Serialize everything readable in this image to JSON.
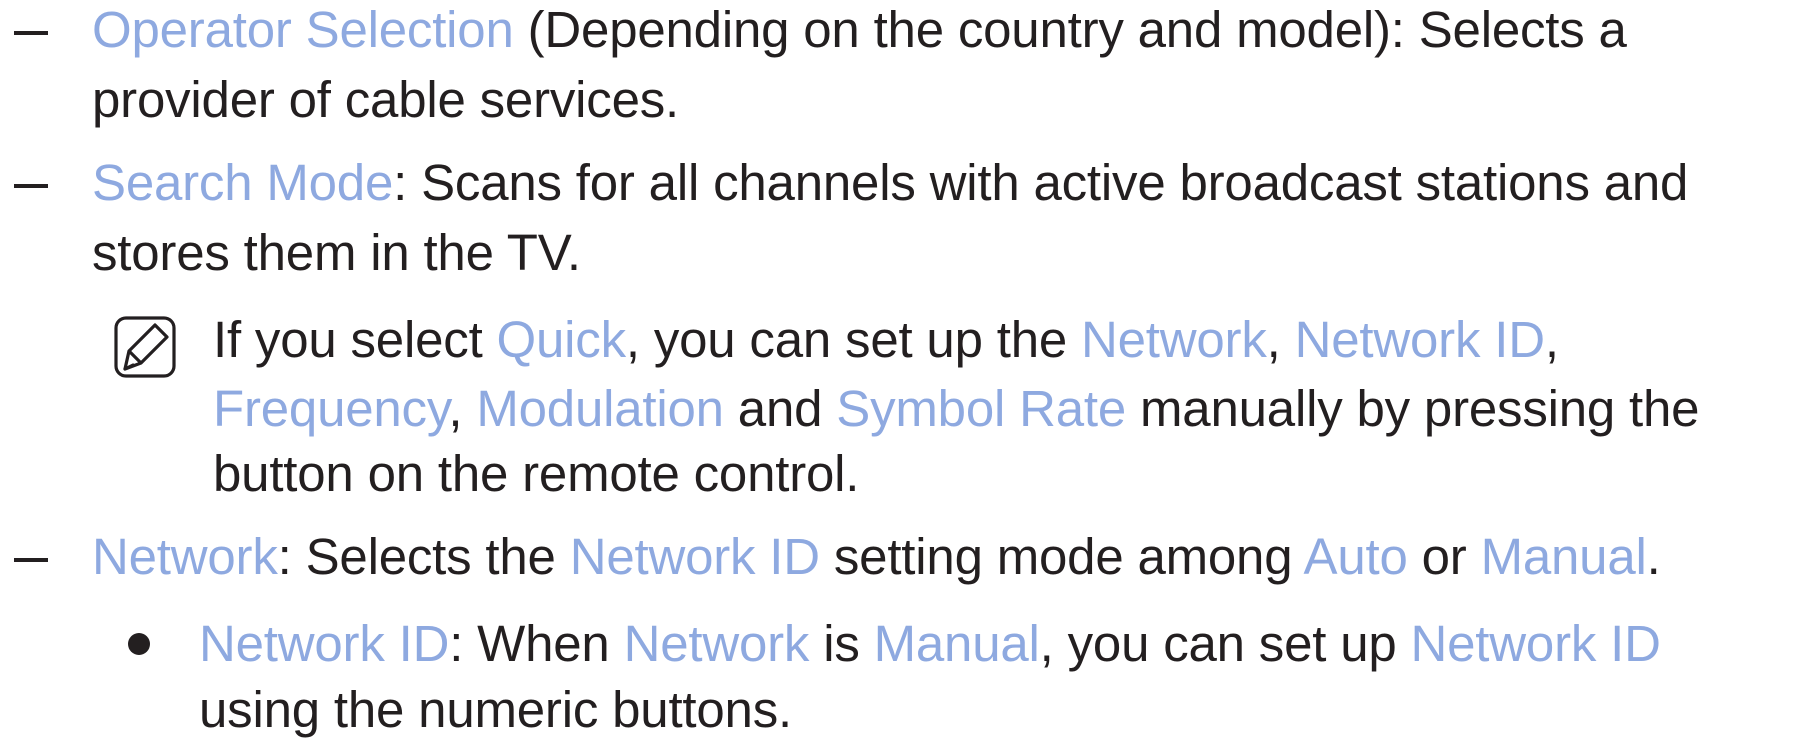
{
  "items": [
    {
      "term": "Operator Selection",
      "line1_rest": " (Depending on the country and model): Selects a",
      "line2": "provider of cable services."
    },
    {
      "term": "Search Mode",
      "line1_rest": ": Scans for all channels with active broadcast stations and",
      "line2": "stores them in the TV."
    }
  ],
  "note": {
    "icon": "note-icon",
    "line1": {
      "t1": "If you select ",
      "quick": "Quick",
      "t2": ", you can set up the ",
      "network": "Network",
      "t3": ", ",
      "network_id": "Network ID",
      "t4": ","
    },
    "line2": {
      "frequency": "Frequency",
      "t1": ", ",
      "modulation": "Modulation",
      "t2": " and ",
      "symbol_rate": "Symbol Rate",
      "t3": " manually by pressing the"
    },
    "line3": "button on the remote control."
  },
  "network_item": {
    "term": "Network",
    "t1": ": Selects the ",
    "network_id": "Network ID",
    "t2": " setting mode among ",
    "auto": "Auto",
    "t3": " or ",
    "manual": "Manual",
    "t4": "."
  },
  "network_id_bullet": {
    "term": "Network ID",
    "t1": ": When ",
    "network": "Network",
    "t2": " is ",
    "manual": "Manual",
    "t3": ", you can set up ",
    "network_id": "Network ID",
    "line2": "using the numeric buttons."
  },
  "colors": {
    "highlight": "#8ea9e0",
    "text": "#231f20"
  }
}
